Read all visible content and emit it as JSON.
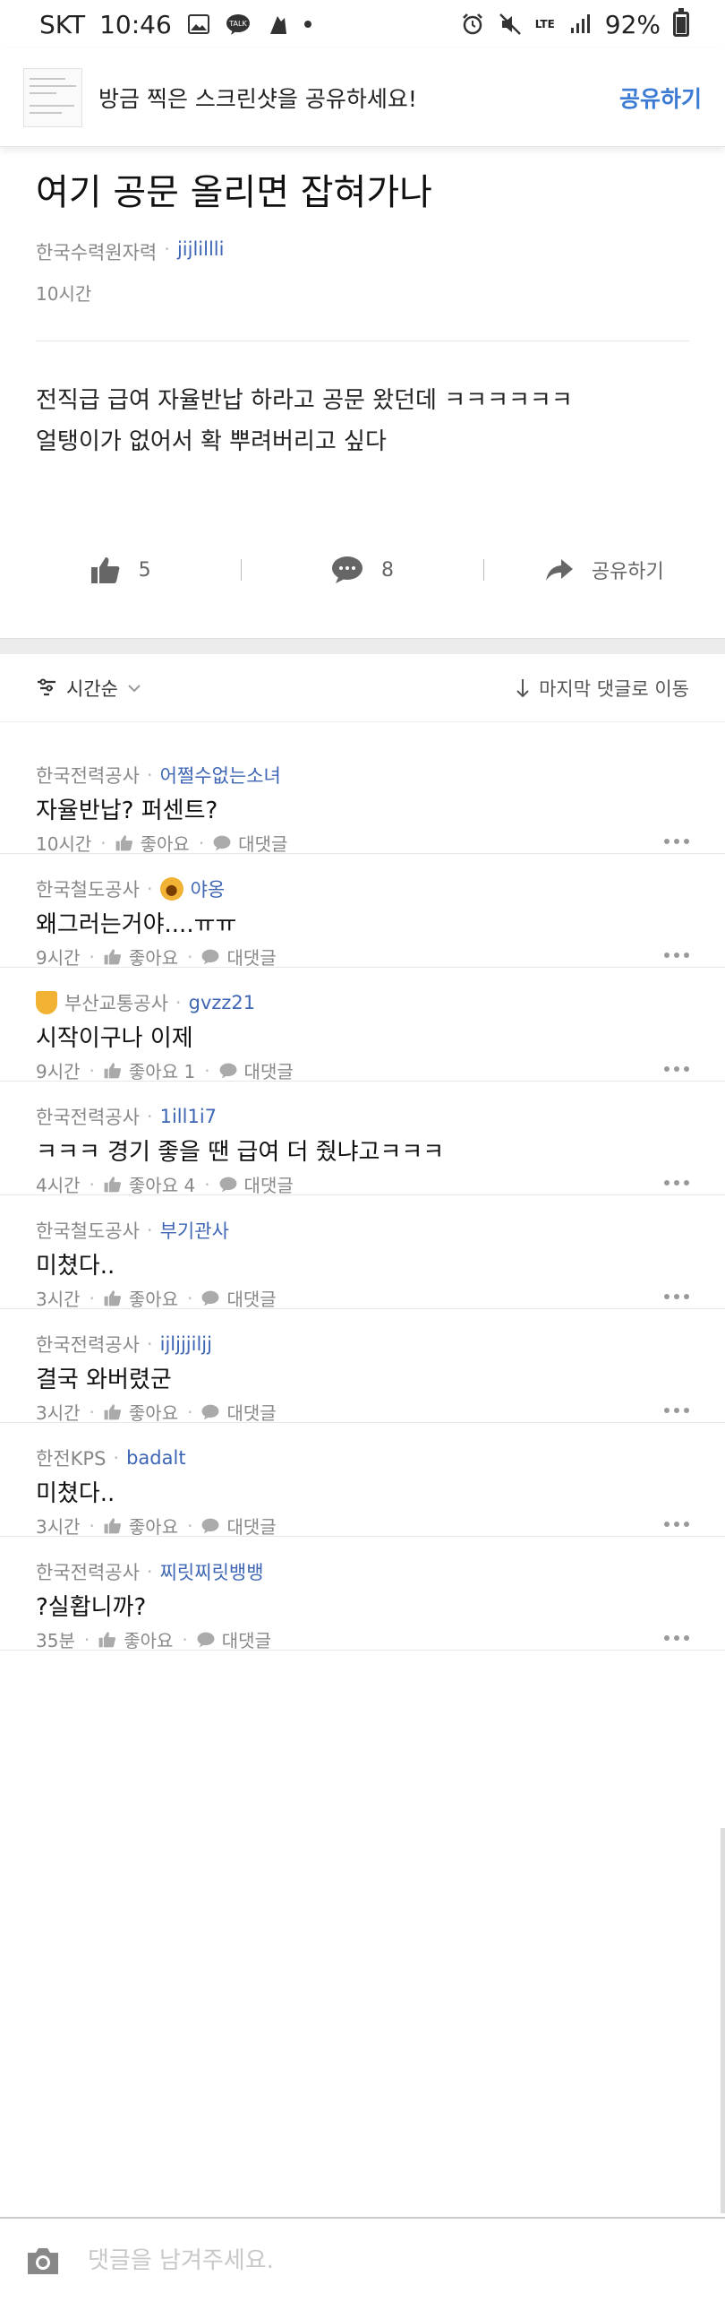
{
  "status_bar": {
    "carrier": "SKT",
    "time": "10:46",
    "network": "LTE",
    "battery": "92%"
  },
  "share_banner": {
    "text": "방금 찍은 스크린샷을 공유하세요!",
    "action": "공유하기"
  },
  "post": {
    "title": "여기 공문 올리면 잡혀가나",
    "org": "한국수력원자력",
    "nick": "jijlillli",
    "time": "10시간",
    "body_line1": "전직급 급여 자율반납 하라고 공문 왔던데 ㅋㅋㅋㅋㅋㅋ",
    "body_line2": "얼탱이가 없어서 확 뿌려버리고 싶다",
    "likes": "5",
    "comments": "8",
    "share_label": "공유하기"
  },
  "sort_bar": {
    "sort_label": "시간순",
    "jump_label": "마지막 댓글로 이동"
  },
  "comments": [
    {
      "org": "한국전력공사",
      "nick": "어쩔수없는소녀",
      "text": "자율반납? 퍼센트?",
      "time": "10시간",
      "like": "좋아요",
      "reply": "대댓글"
    },
    {
      "org": "한국철도공사",
      "nick": "야옹",
      "text": "왜그러는거야....ㅠㅠ",
      "time": "9시간",
      "like": "좋아요",
      "reply": "대댓글"
    },
    {
      "org": "부산교통공사",
      "nick": "gvzz21",
      "text": "시작이구나 이제",
      "time": "9시간",
      "like": "좋아요 1",
      "reply": "대댓글"
    },
    {
      "org": "한국전력공사",
      "nick": "1ill1i7",
      "text": "ㅋㅋㅋ 경기 좋을 땐 급여 더 줬냐고ㅋㅋㅋ",
      "time": "4시간",
      "like": "좋아요 4",
      "reply": "대댓글"
    },
    {
      "org": "한국철도공사",
      "nick": "부기관사",
      "text": "미쳤다..",
      "time": "3시간",
      "like": "좋아요",
      "reply": "대댓글"
    },
    {
      "org": "한국전력공사",
      "nick": "ijljjjiljj",
      "text": "결국 와버렸군",
      "time": "3시간",
      "like": "좋아요",
      "reply": "대댓글"
    },
    {
      "org": "한전KPS",
      "nick": "badalt",
      "text": "미쳤다..",
      "time": "3시간",
      "like": "좋아요",
      "reply": "대댓글"
    },
    {
      "org": "한국전력공사",
      "nick": "찌릿찌릿뱅뱅",
      "text": "?실홥니까?",
      "time": "35분",
      "like": "좋아요",
      "reply": "대댓글"
    }
  ],
  "comment_input": {
    "placeholder": "댓글을 남겨주세요."
  },
  "colors": {
    "accent": "#3b7bd3",
    "nick": "#3e66b5"
  }
}
